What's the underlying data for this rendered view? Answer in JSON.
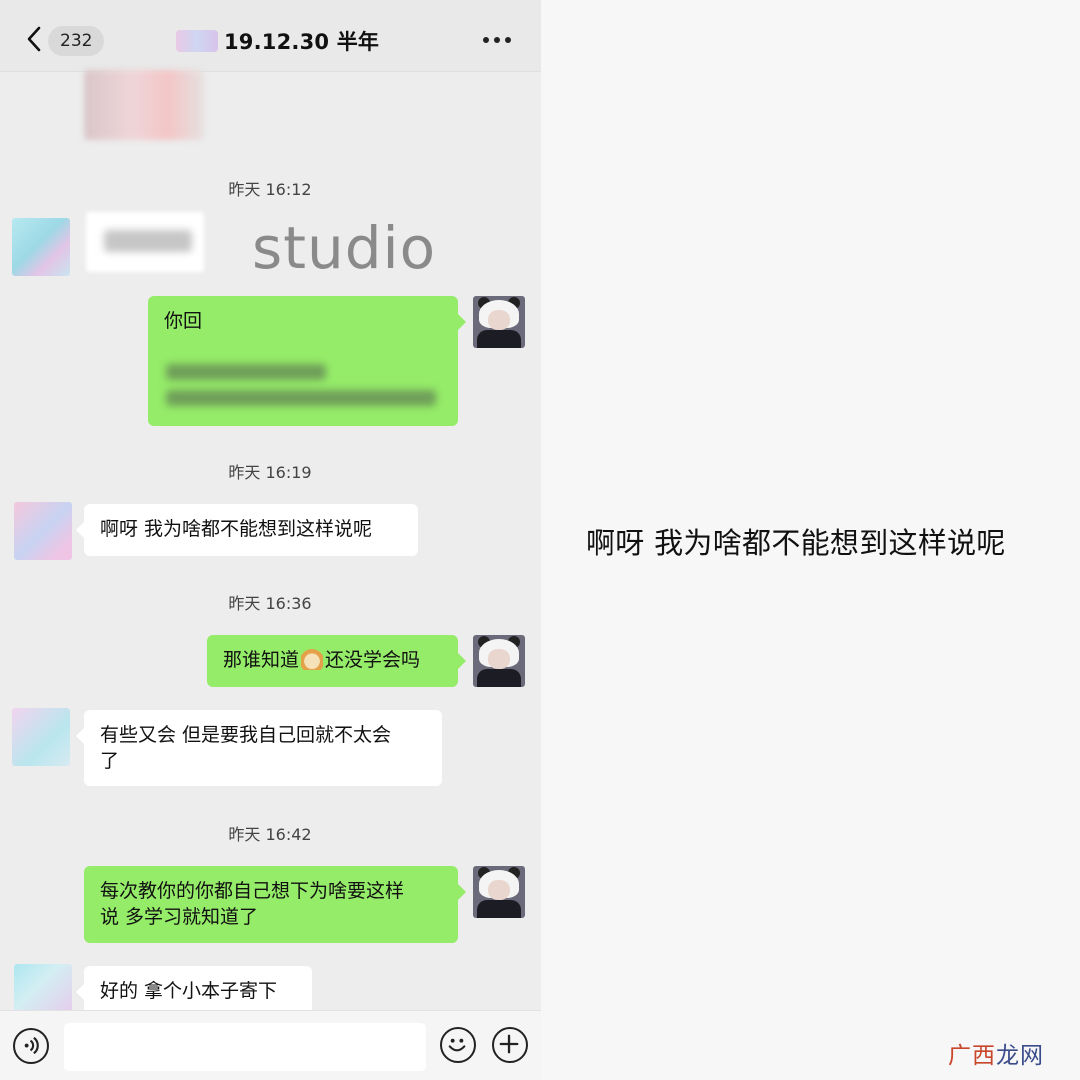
{
  "header": {
    "unread_count": "232",
    "title": "19.12.30 半年",
    "back_icon": "chevron-left-icon",
    "more_icon": "more-dots-icon"
  },
  "messages": {
    "t1": "昨天 16:12",
    "sticker_text": "studio",
    "msg1_head": "你回",
    "t2": "昨天 16:19",
    "msg2": "啊呀 我为啥都不能想到这样说呢",
    "t3": "昨天 16:36",
    "msg3_a": "那谁知道",
    "msg3_b": "还没学会吗",
    "msg3_emoji": "doge-emoji",
    "msg4_line1": "有些又会 但是要我自己回就不太会",
    "msg4_line2": "了",
    "t4": "昨天 16:42",
    "msg5_line1": "每次教你的你都自己想下为啥要这样",
    "msg5_line2": "说 多学习就知道了",
    "msg6": "好的 拿个小本子寄下"
  },
  "input_bar": {
    "voice_icon": "voice-icon",
    "emoji_icon": "smile-icon",
    "add_icon": "plus-icon"
  },
  "right_panel": {
    "quote": "啊呀 我为啥都不能想到这样说呢",
    "watermark_a": "广西",
    "watermark_b": "龙网"
  },
  "colors": {
    "sent_bubble": "#95ec69",
    "received_bubble": "#ffffff",
    "chat_background": "#ededed",
    "watermark_red": "#c8462a",
    "watermark_blue": "#3b4c8c"
  }
}
